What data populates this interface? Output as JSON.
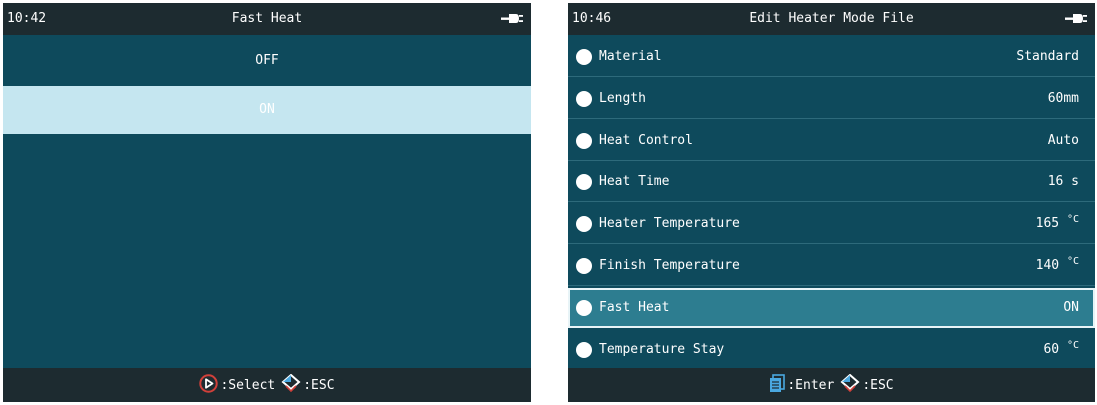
{
  "left": {
    "time": "10:42",
    "title": "Fast Heat",
    "power_icon": "plug-icon",
    "options": [
      {
        "label": "OFF",
        "selected": false
      },
      {
        "label": "ON",
        "selected": true
      }
    ],
    "footer": {
      "select_icon": "play-circle-icon",
      "select_label": ":Select",
      "esc_icon": "diamond-arrow-icon",
      "esc_label": ":ESC"
    }
  },
  "right": {
    "time": "10:46",
    "title": "Edit Heater Mode File",
    "power_icon": "plug-icon",
    "rows": [
      {
        "label": "Material",
        "value": "Standard",
        "unit": ""
      },
      {
        "label": "Length",
        "value": "60mm",
        "unit": ""
      },
      {
        "label": "Heat Control",
        "value": "Auto",
        "unit": ""
      },
      {
        "label": "Heat Time",
        "value": "16 s",
        "unit": ""
      },
      {
        "label": "Heater Temperature",
        "value": "165 ",
        "unit": "°C"
      },
      {
        "label": "Finish Temperature",
        "value": "140 ",
        "unit": "°C"
      },
      {
        "label": "Fast Heat",
        "value": "ON",
        "unit": ""
      },
      {
        "label": "Temperature Stay",
        "value": "60 ",
        "unit": "°C"
      }
    ],
    "selected_row": 6,
    "footer": {
      "enter_icon": "document-icon",
      "enter_label": ":Enter",
      "esc_icon": "diamond-arrow-icon",
      "esc_label": ":ESC"
    }
  },
  "colors": {
    "screen_bg": "#0e4a5c",
    "bar_bg": "#1d2b30",
    "highlight_left": "#c5e6f0",
    "highlight_right": "#2d7d90",
    "select_icon": "#d0403a",
    "enter_icon": "#4aa8e0"
  }
}
